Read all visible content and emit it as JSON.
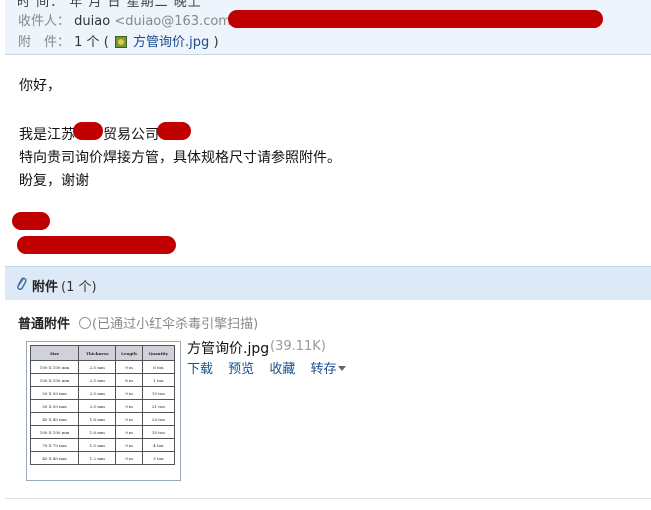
{
  "header": {
    "cutoff_line": "时  间：      年 月  日  星期二 晚上",
    "to_label": "收件人：",
    "to_name": "duiao",
    "to_address": "<duiao@163.com>;",
    "attach_label": "附　件：",
    "attach_count": "1 个 (",
    "attach_file": "方管询价.jpg",
    "attach_close": ")"
  },
  "body": {
    "greeting": "你好，",
    "line_intro_a": "我是江苏",
    "line_intro_b": "贸易公司",
    "line_request": "特向贵司询价焊接方管，具体规格尺寸请参照附件。",
    "line_closing": "盼复，谢谢"
  },
  "attachments": {
    "title": "附件",
    "count": "(1 个)",
    "normal_title": "普通附件",
    "scan_status": "(已通过小红伞杀毒引擎扫描)",
    "file": {
      "name": "方管询价.jpg",
      "size": "(39.11K)",
      "actions": [
        "下载",
        "预览",
        "收藏",
        "转存"
      ]
    },
    "thumbnail": {
      "headers": [
        "Size",
        "Thickness",
        "Length",
        "Quantity"
      ],
      "rows": [
        [
          "100 X 100 mm",
          "2.5 mm",
          "9 m",
          "6 ton"
        ],
        [
          "100 X 100 mm",
          "2.5 mm",
          "6 m",
          "1 ton"
        ],
        [
          "50 X 50 mm",
          "2.5 mm",
          "9 m",
          "10 ton"
        ],
        [
          "50 X 50 mm",
          "2.5 mm",
          "9 m",
          "21 ton"
        ],
        [
          "40 X 40 mm",
          "1.8 mm",
          "9 m",
          "20 ton"
        ],
        [
          "100 X 100 mm",
          "1.8 mm",
          "9 m",
          "10 ton"
        ],
        [
          "70 X 70 mm",
          "1.5 mm",
          "9 m",
          "4 ton"
        ],
        [
          "40 X 40 mm",
          "1.2 mm",
          "9 m",
          "3 ton"
        ]
      ]
    }
  },
  "colors": {
    "redaction": "#c00000",
    "header_bg": "#eef4fb",
    "link": "#1a4d8f",
    "section_bg": "#dde9f6"
  }
}
